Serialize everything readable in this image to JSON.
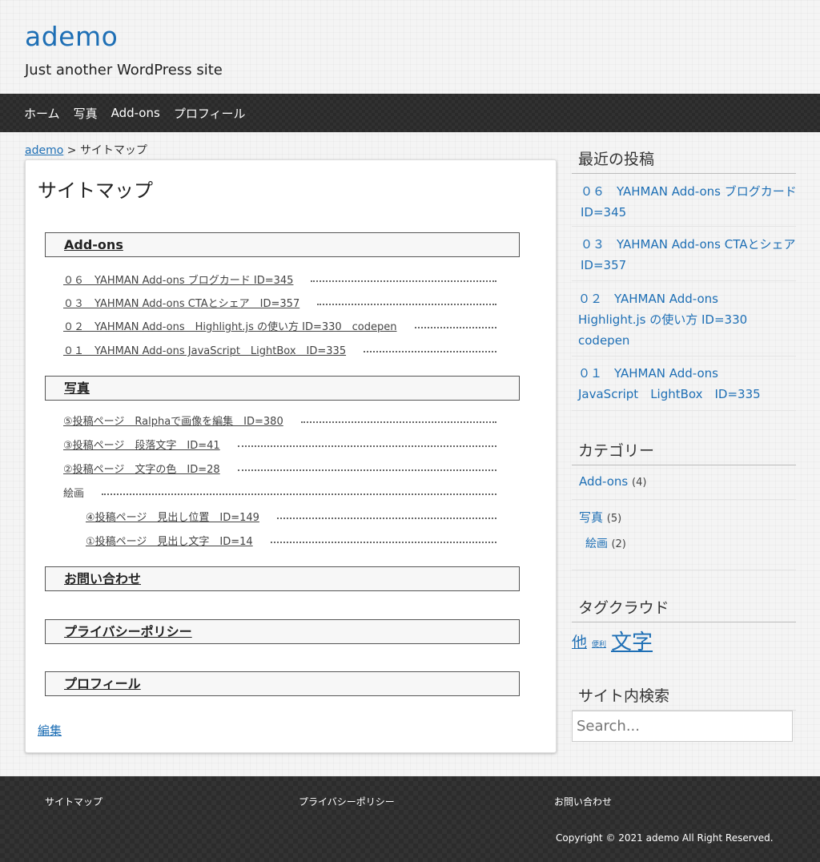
{
  "header": {
    "site_title": "ademo",
    "tagline": "Just another WordPress site"
  },
  "nav": {
    "items": [
      "ホーム",
      "写真",
      "Add-ons",
      "プロフィール"
    ]
  },
  "breadcrumb": {
    "home": "ademo",
    "separator": " > ",
    "current": "サイトマップ"
  },
  "main": {
    "title": "サイトマップ",
    "sections": [
      {
        "heading": "Add-ons",
        "items": [
          "０６　YAHMAN Add-ons ブログカード ID=345",
          "０３　YAHMAN Add-ons CTAとシェア　ID=357",
          "０２　YAHMAN Add-ons　Highlight.js の使い方 ID=330　codepen",
          "０１　YAHMAN Add-ons JavaScript　LightBox　ID=335"
        ]
      },
      {
        "heading": "写真",
        "items": [
          "⑤投稿ページ　Ralphaで画像を編集　ID=380",
          "③投稿ページ　段落文字　ID=41",
          "②投稿ページ　文字の色　ID=28",
          "絵画"
        ],
        "children": [
          "④投稿ページ　見出し位置　ID=149",
          "①投稿ページ　見出し文字　ID=14"
        ]
      },
      {
        "heading": "お問い合わせ"
      },
      {
        "heading": "プライバシーポリシー"
      },
      {
        "heading": "プロフィール"
      }
    ],
    "edit_label": "編集"
  },
  "sidebar": {
    "recent": {
      "title": "最近の投稿",
      "posts": [
        "０６　YAHMAN Add-ons ブログカード ID=345",
        "０３　YAHMAN Add-ons CTAとシェア　ID=357",
        "０２　YAHMAN Add-ons Highlight.js の使い方 ID=330 codepen",
        "０１　YAHMAN Add-ons JavaScript　LightBox　ID=335"
      ]
    },
    "categories": {
      "title": "カテゴリー",
      "items": [
        {
          "name": "Add-ons",
          "count": "(4)"
        },
        {
          "name": "写真",
          "count": "(5)"
        },
        {
          "name": "絵画",
          "count": "(2)"
        }
      ]
    },
    "tags": {
      "title": "タグクラウド",
      "items": [
        "他",
        "便利",
        "文字"
      ]
    },
    "search": {
      "title": "サイト内検索",
      "placeholder": "Search..."
    }
  },
  "footer": {
    "links": [
      "サイトマップ",
      "プライバシーポリシー",
      "お問い合わせ"
    ],
    "copyright": "Copyright © 2021 ademo All Right Reserved."
  }
}
